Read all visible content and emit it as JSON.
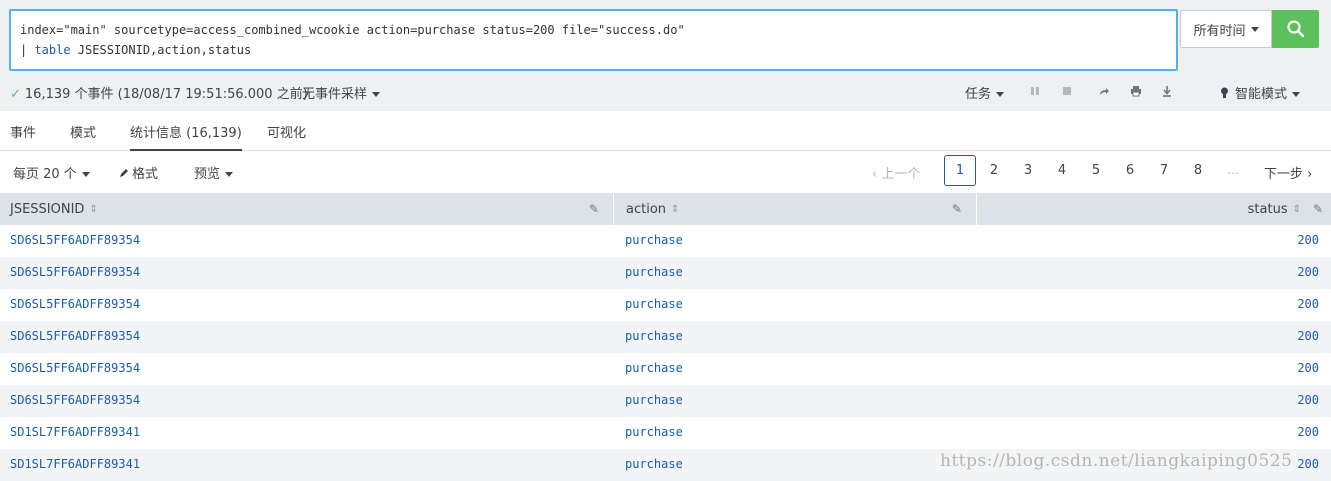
{
  "search": {
    "line1": "index=\"main\" sourcetype=access_combined_wcookie action=purchase status=200 file=\"success.do\"",
    "line2_pipe": "| ",
    "line2_kw": "table",
    "line2_rest": " JSESSIONID,action,status",
    "time_range": "所有时间",
    "go_icon": "search-icon",
    "accent": "#4fb3e5",
    "go_color": "#5cc05c"
  },
  "status": {
    "check": "✓",
    "text": "16,139 个事件 (18/08/17 19:51:56.000 之前)",
    "sampling": "无事件采样",
    "jobs": "任务",
    "mode": "智能模式"
  },
  "tabs": [
    {
      "label": "事件"
    },
    {
      "label": "模式"
    },
    {
      "label": "统计信息 (16,139)"
    },
    {
      "label": "可视化"
    }
  ],
  "toolbar": {
    "per_page": "每页 20 个",
    "format": "格式",
    "preview": "预览"
  },
  "pager": {
    "prev": "上一个",
    "pages": [
      "1",
      "2",
      "3",
      "4",
      "5",
      "6",
      "7",
      "8"
    ],
    "current": "1",
    "ellipsis": "...",
    "next": "下一步"
  },
  "table": {
    "columns": [
      "JSESSIONID",
      "action",
      "status"
    ],
    "rows": [
      [
        "SD6SL5FF6ADFF89354",
        "purchase",
        "200"
      ],
      [
        "SD6SL5FF6ADFF89354",
        "purchase",
        "200"
      ],
      [
        "SD6SL5FF6ADFF89354",
        "purchase",
        "200"
      ],
      [
        "SD6SL5FF6ADFF89354",
        "purchase",
        "200"
      ],
      [
        "SD6SL5FF6ADFF89354",
        "purchase",
        "200"
      ],
      [
        "SD6SL5FF6ADFF89354",
        "purchase",
        "200"
      ],
      [
        "SD1SL7FF6ADFF89341",
        "purchase",
        "200"
      ],
      [
        "SD1SL7FF6ADFF89341",
        "purchase",
        "200"
      ]
    ]
  },
  "watermark": "https://blog.csdn.net/liangkaiping0525"
}
